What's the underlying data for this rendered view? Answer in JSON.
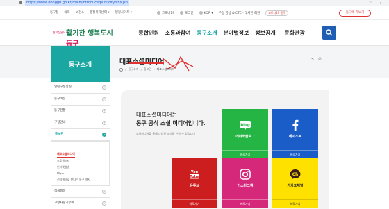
{
  "browser": {
    "url": "https://www.donggu.go.kr/main/introduce/publicity/sns.jsp"
  },
  "util": {
    "links": [
      "동구청",
      "의회",
      "보건소",
      "행정복지센터 ▾",
      "행정사이트 ▾"
    ],
    "right": [
      "코로나19",
      "로그인",
      "KOR ▾",
      "구청 영상 & CTC · 대세한 회원"
    ],
    "covid_btn": "코로나19 동구",
    "red_btn": "동구에 가보기"
  },
  "logo": {
    "small": "살고싶은도시",
    "big_a": "활기찬 행복도시 ",
    "big_b": "동구"
  },
  "gnb": [
    "종합민원",
    "소통과참여",
    "동구소개",
    "분야별정보",
    "정보공개",
    "문화관광"
  ],
  "page": {
    "title": "대표소셜미디어",
    "breadcrumb": [
      "동구소개",
      "홍보관",
      "대표소셜미디어"
    ],
    "tools": [
      "share",
      "print"
    ]
  },
  "sidebar": {
    "title": "동구소개",
    "items": [
      {
        "label": "열린구청장실"
      },
      {
        "label": "동구비전"
      },
      {
        "label": "동구현황"
      },
      {
        "label": "구청안내"
      },
      {
        "label": "홍보관"
      }
    ],
    "sub": [
      "대표소셜미디어",
      "포토갤러리",
      "인터넷방송",
      "N뉴스",
      "전자책으로 만나는 동구 역사"
    ],
    "after": [
      {
        "label": "적극행정"
      },
      {
        "label": "고향사랑기부제"
      }
    ]
  },
  "intro": {
    "line1": "대표소셜미디어는",
    "line2": "동구 공식 소셜 미디어입니다.",
    "line3": "소셜미디어를 통해 다양한 소식을 만날 수 있습니다"
  },
  "cards": [
    {
      "name": "네이버블로그",
      "go": "바로가기",
      "color": "#25b544",
      "icon": "blog-icon"
    },
    {
      "name": "페이스북",
      "go": "바로가기",
      "color": "#1a5cc8",
      "icon": "facebook-icon"
    },
    {
      "name": "유튜브",
      "go": "바로가기",
      "color": "#cc1e1e",
      "icon": "youtube-icon"
    },
    {
      "name": "인스타그램",
      "go": "바로가기",
      "color": "#d6287a",
      "icon": "instagram-icon"
    },
    {
      "name": "카카오채널",
      "go": "바로가기",
      "color": "#ffe100",
      "icon": "kakao-icon"
    }
  ]
}
